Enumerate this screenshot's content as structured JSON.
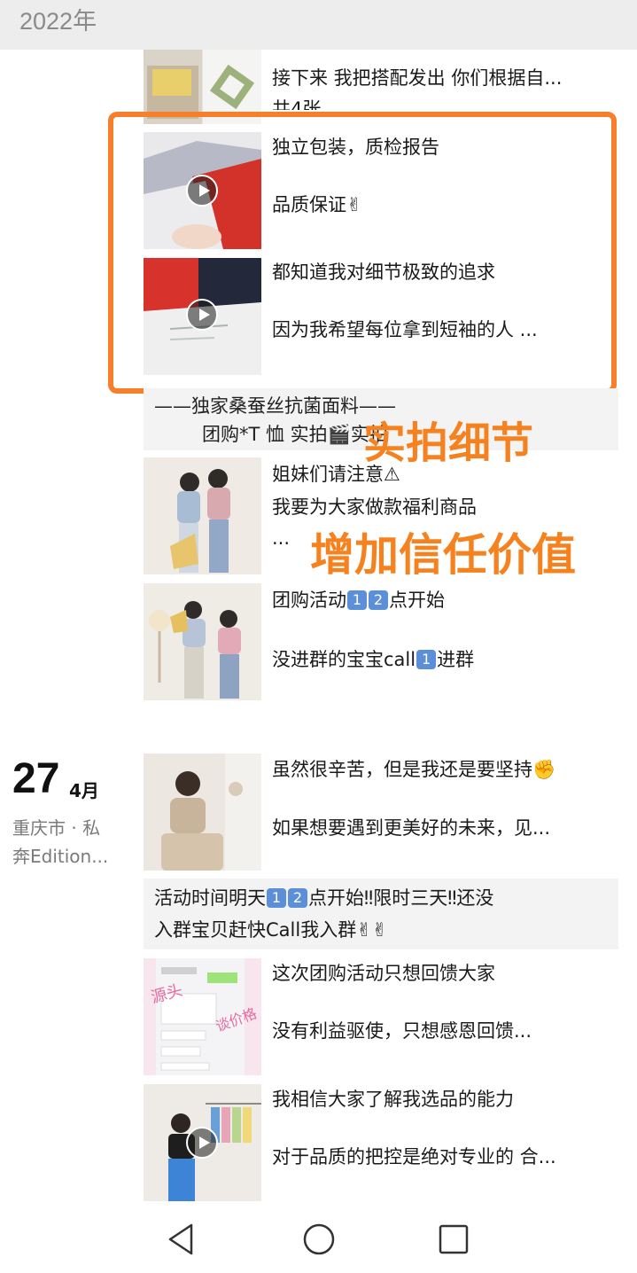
{
  "header": {
    "year": "2022年"
  },
  "posts": [
    {
      "line1": "接下来 我把搭配发出  你们根据自...",
      "line2": "共4张"
    },
    {
      "line1": "独立包装，质检报告",
      "line2": "品质保证✌"
    },
    {
      "line1": "都知道我对细节极致的追求",
      "line2": "因为我希望每位拿到短袖的人  ..."
    },
    {
      "line1": "姐妹们请注意⚠",
      "line2": "我要为大家做款福利商品",
      "line3": "..."
    },
    {
      "line1_pre": "团购活动",
      "line1_post": "点开始",
      "line2_pre": "没进群的宝宝call",
      "line2_post": "进群"
    },
    {
      "line1": "虽然很辛苦，但是我还是要坚持✊",
      "line2": "如果想要遇到更美好的未来，见..."
    },
    {
      "line1": "这次团购活动只想回馈大家",
      "line2": "没有利益驱使，只想感恩回馈..."
    },
    {
      "line1": "我相信大家了解我选品的能力",
      "line2": "对于品质的把控是绝对专业的 合..."
    }
  ],
  "shared1": {
    "line1": "——独家桑蚕丝抗菌面料——",
    "line2": "团购*T 恤 实拍🎬实拍"
  },
  "shared2": {
    "line1_a": "活动时间明天",
    "line1_b": "点开始‼限时三天‼还没",
    "line2": "入群宝贝赶快Call我入群✌✌"
  },
  "badges": {
    "one": "1",
    "two": "2"
  },
  "date": {
    "day": "27",
    "month": "4月",
    "loc1": "重庆市 · 私",
    "loc2": "奔Edition..."
  },
  "overlay": {
    "line1": "实拍细节",
    "line2": "增加信任价值",
    "color": "#f5821f"
  },
  "thumb_overlay": {
    "left": "源头",
    "right": "谈价格"
  },
  "navbar": {
    "back": "back-icon",
    "home": "home-icon",
    "recent": "recents-icon"
  }
}
